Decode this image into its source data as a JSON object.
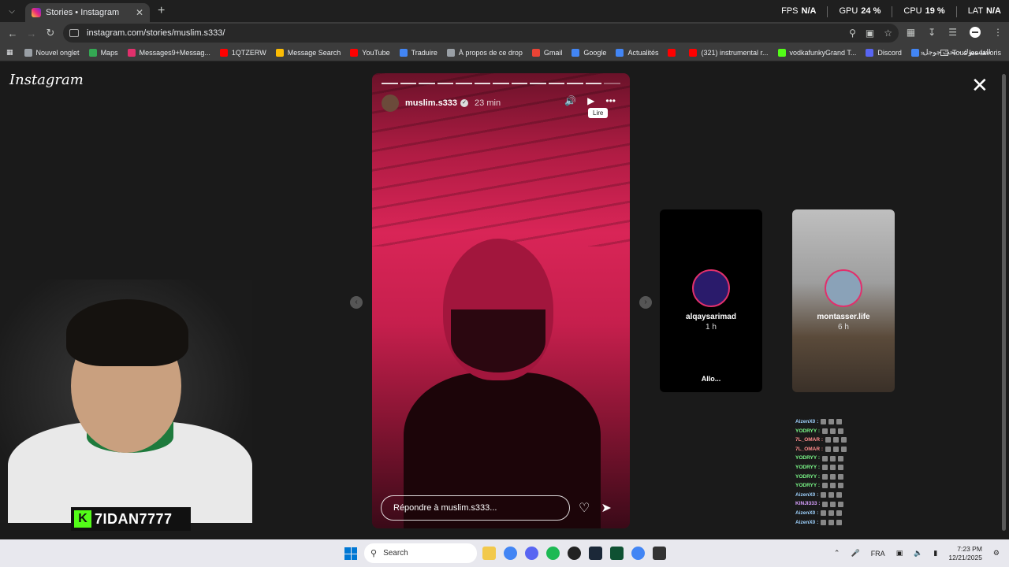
{
  "browser": {
    "tab_title": "Stories • Instagram",
    "new_tab": "+",
    "url": "instagram.com/stories/muslim.s333/",
    "perf": [
      {
        "label": "FPS",
        "value": "N/A"
      },
      {
        "label": "GPU",
        "value": "24 %"
      },
      {
        "label": "CPU",
        "value": "19 %"
      },
      {
        "label": "LAT",
        "value": "N/A"
      }
    ],
    "bookmarks": [
      {
        "label": "Nouvel onglet",
        "color": "#9aa0a6"
      },
      {
        "label": "Maps",
        "color": "#34a853"
      },
      {
        "label": "Messages9+Messag...",
        "color": "#e1306c"
      },
      {
        "label": "1QTZERW",
        "color": "#ff0000"
      },
      {
        "label": "Message Search",
        "color": "#fbbc04"
      },
      {
        "label": "YouTube",
        "color": "#ff0000"
      },
      {
        "label": "Traduire",
        "color": "#4285f4"
      },
      {
        "label": "À propos de ce drop",
        "color": "#9aa0a6"
      },
      {
        "label": "Gmail",
        "color": "#ea4335"
      },
      {
        "label": "Google",
        "color": "#4285f4"
      },
      {
        "label": "Actualités",
        "color": "#4285f4"
      },
      {
        "label": "",
        "color": "#ff0000"
      },
      {
        "label": "(321) instrumental r...",
        "color": "#ff0000"
      },
      {
        "label": "vodkafunkyGrand T...",
        "color": "#53fc18"
      },
      {
        "label": "Discord",
        "color": "#5865f2"
      },
      {
        "label": "الفيسبوك - بحث جوجل",
        "color": "#4285f4"
      }
    ],
    "all_bookmarks": "Tous les favoris"
  },
  "instagram": {
    "logo": "Instagram",
    "story": {
      "username": "muslim.s333",
      "time": "23 min",
      "tooltip": "Lire",
      "reply_placeholder": "Répondre à muslim.s333...",
      "segments_total": 13,
      "segments_viewed": 12
    },
    "previews": [
      {
        "name": "alqaysarimad",
        "time": "1 h",
        "caption": "Allo..."
      },
      {
        "name": "montasser.life",
        "time": "6 h",
        "caption": ""
      }
    ]
  },
  "chat": [
    {
      "user": "AizenX0 :",
      "color": "#9fd3ff"
    },
    {
      "user": "YODRYY :",
      "color": "#7cfc8a"
    },
    {
      "user": "7L_OMAR :",
      "color": "#ff8c8c"
    },
    {
      "user": "7L_OMAR :",
      "color": "#ff8c8c"
    },
    {
      "user": "YODRYY :",
      "color": "#7cfc8a"
    },
    {
      "user": "YODRYY :",
      "color": "#7cfc8a"
    },
    {
      "user": "YODRYY :",
      "color": "#7cfc8a"
    },
    {
      "user": "YODRYY :",
      "color": "#7cfc8a"
    },
    {
      "user": "AizenX0 :",
      "color": "#9fd3ff"
    },
    {
      "user": "KINJI333 :",
      "color": "#d9a0ff"
    },
    {
      "user": "AizenX0 :",
      "color": "#9fd3ff"
    },
    {
      "user": "AizenX0 :",
      "color": "#9fd3ff"
    }
  ],
  "streamer": {
    "badge": "K",
    "name": "7IDAN7777"
  },
  "taskbar": {
    "search": "Search",
    "language": "FRA",
    "time": "7:23 PM",
    "date": "12/21/2025"
  }
}
